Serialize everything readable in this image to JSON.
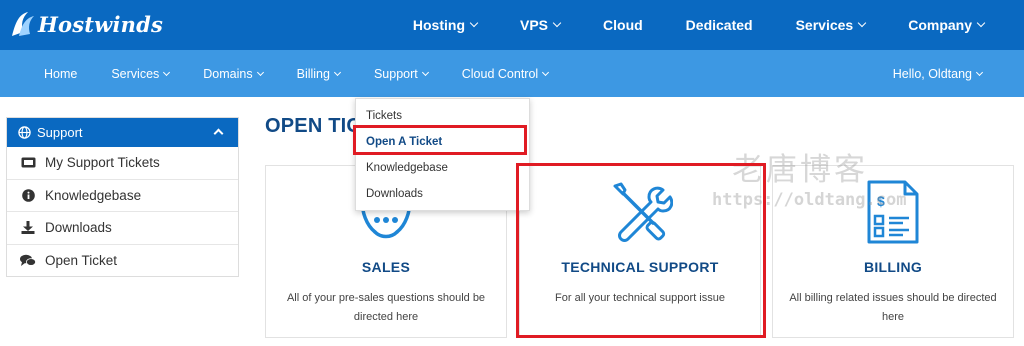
{
  "brand": {
    "name": "Hostwinds"
  },
  "top_nav": [
    {
      "label": "Hosting",
      "has_dropdown": true
    },
    {
      "label": "VPS",
      "has_dropdown": true
    },
    {
      "label": "Cloud",
      "has_dropdown": false
    },
    {
      "label": "Dedicated",
      "has_dropdown": false
    },
    {
      "label": "Services",
      "has_dropdown": true
    },
    {
      "label": "Company",
      "has_dropdown": true
    }
  ],
  "sub_nav": [
    {
      "label": "Home"
    },
    {
      "label": "Services"
    },
    {
      "label": "Domains"
    },
    {
      "label": "Billing"
    },
    {
      "label": "Support"
    },
    {
      "label": "Cloud Control"
    }
  ],
  "user": {
    "greeting": "Hello, Oldtang"
  },
  "support_dropdown": {
    "items": [
      "Tickets",
      "Open A Ticket",
      "Knowledgebase",
      "Downloads"
    ],
    "active": "Open A Ticket"
  },
  "sidebar": {
    "header": "Support",
    "items": [
      {
        "label": "My Support Tickets",
        "icon": "ticket-icon"
      },
      {
        "label": "Knowledgebase",
        "icon": "info-icon"
      },
      {
        "label": "Downloads",
        "icon": "download-icon"
      },
      {
        "label": "Open Ticket",
        "icon": "comments-icon"
      }
    ]
  },
  "page": {
    "title": "OPEN TICKET"
  },
  "cards": [
    {
      "title": "SALES",
      "description": "All of your pre-sales questions should be directed here",
      "icon": "headset-icon"
    },
    {
      "title": "TECHNICAL SUPPORT",
      "description": "For all your technical support issue",
      "icon": "tools-icon"
    },
    {
      "title": "BILLING",
      "description": "All billing related issues should be directed here",
      "icon": "invoice-icon"
    }
  ],
  "watermark": {
    "line1": "老唐博客",
    "line2": "https://oldtang.com"
  },
  "colors": {
    "top_bar": "#0a69c1",
    "sub_bar": "#3d98e3",
    "heading": "#114a86",
    "highlight": "#e01b23",
    "icon_blue": "#1f86d6"
  }
}
